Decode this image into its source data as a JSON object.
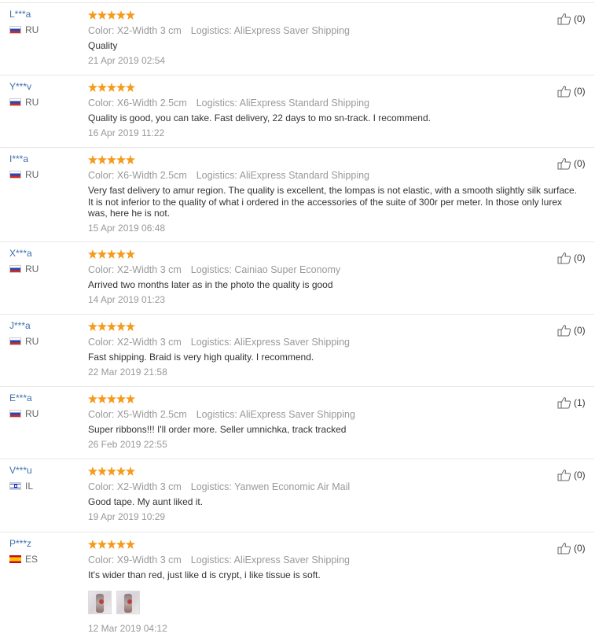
{
  "reviews": [
    {
      "user": "L***a",
      "country": "RU",
      "flag": "ru",
      "color": "Color: X2-Width 3 cm",
      "logistics": "Logistics: AliExpress Saver Shipping",
      "text": "Quality",
      "date": "21 Apr 2019 02:54",
      "likes": "(0)",
      "rating": 5
    },
    {
      "user": "Y***v",
      "country": "RU",
      "flag": "ru",
      "color": "Color: X6-Width 2.5cm",
      "logistics": "Logistics: AliExpress Standard Shipping",
      "text": "Quality is good, you can take. Fast delivery, 22 days to mo sn-track. I recommend.",
      "date": "16 Apr 2019 11:22",
      "likes": "(0)",
      "rating": 5
    },
    {
      "user": "I***a",
      "country": "RU",
      "flag": "ru",
      "color": "Color: X6-Width 2.5cm",
      "logistics": "Logistics: AliExpress Standard Shipping",
      "text": "Very fast delivery to amur region. The quality is excellent, the lompas is not elastic, with a smooth slightly silk surface. It is not inferior to the quality of what i ordered in the accessories of the suite of 300r per meter. In those only lurex was, here he is not.",
      "date": "15 Apr 2019 06:48",
      "likes": "(0)",
      "rating": 5
    },
    {
      "user": "X***a",
      "country": "RU",
      "flag": "ru",
      "color": "Color: X2-Width 3 cm",
      "logistics": "Logistics: Cainiao Super Economy",
      "text": "Arrived two months later as in the photo the quality is good",
      "date": "14 Apr 2019 01:23",
      "likes": "(0)",
      "rating": 5
    },
    {
      "user": "J***a",
      "country": "RU",
      "flag": "ru",
      "color": "Color: X2-Width 3 cm",
      "logistics": "Logistics: AliExpress Saver Shipping",
      "text": "Fast shipping. Braid is very high quality. I recommend.",
      "date": "22 Mar 2019 21:58",
      "likes": "(0)",
      "rating": 5
    },
    {
      "user": "E***a",
      "country": "RU",
      "flag": "ru",
      "color": "Color: X5-Width 2.5cm",
      "logistics": "Logistics: AliExpress Saver Shipping",
      "text": "Super ribbons!!! I'll order more. Seller umnichka, track tracked",
      "date": "26 Feb 2019 22:55",
      "likes": "(1)",
      "rating": 5
    },
    {
      "user": "V***u",
      "country": "IL",
      "flag": "il",
      "color": "Color: X2-Width 3 cm",
      "logistics": "Logistics: Yanwen Economic Air Mail",
      "text": "Good tape. My aunt liked it.",
      "date": "19 Apr 2019 10:29",
      "likes": "(0)",
      "rating": 5
    },
    {
      "user": "P***z",
      "country": "ES",
      "flag": "es",
      "color": "Color: X9-Width 3 cm",
      "logistics": "Logistics: AliExpress Saver Shipping",
      "text": "It's wider than red, just like d is crypt, i like tissue is soft.",
      "date": "12 Mar 2019 04:12",
      "likes": "(0)",
      "rating": 5,
      "photos": 2
    }
  ],
  "colors": {
    "username": "#3e6fb0",
    "star": "#f59a1b",
    "meta": "#999999"
  },
  "icons": {
    "like": "thumbs-up-icon",
    "rating": "star-icon"
  }
}
